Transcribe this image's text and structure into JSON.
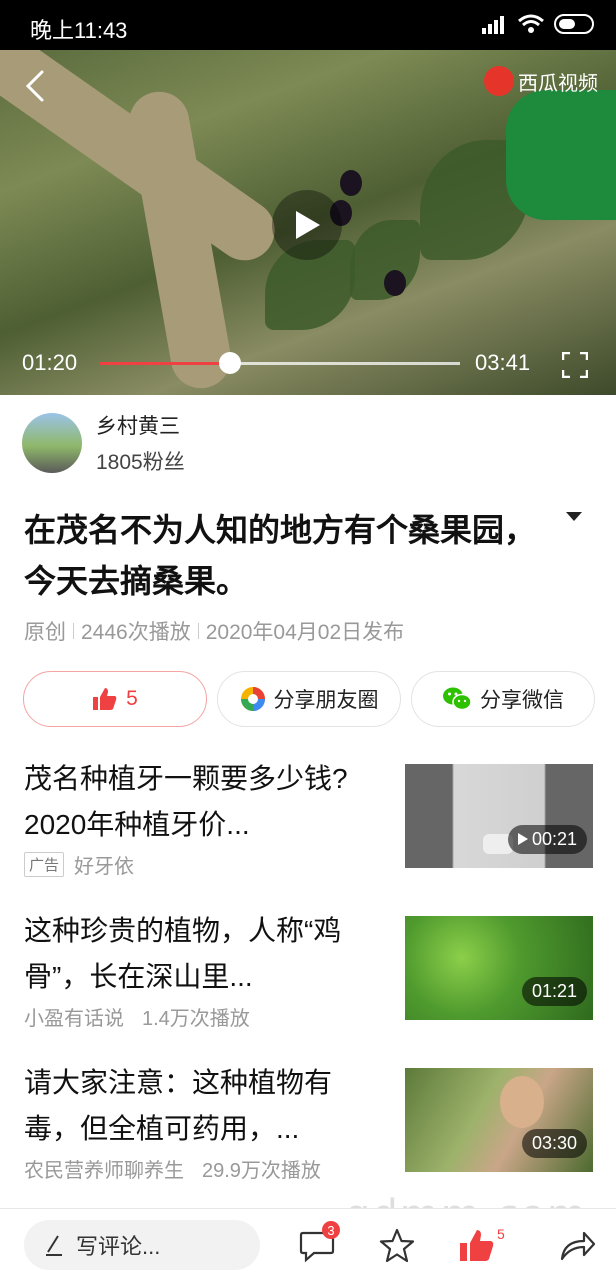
{
  "status_bar": {
    "time": "晚上11:43"
  },
  "video": {
    "source_logo": "西瓜视频",
    "current_time": "01:20",
    "total_time": "03:41",
    "progress": 0.36
  },
  "author": {
    "name": "乡村黄三",
    "fans": "1805粉丝"
  },
  "article": {
    "title": "在茂名不为人知的地方有个桑果园，今天去摘桑果。",
    "meta": [
      "原创",
      "2446次播放",
      "2020年04月02日发布"
    ]
  },
  "actions": {
    "like_count": "5",
    "share_moments": "分享朋友圈",
    "share_wechat": "分享微信"
  },
  "feed": [
    {
      "title": "茂名种植牙一颗要多少钱? 2020年种植牙价...",
      "ad_tag": "广告",
      "source": "好牙依",
      "count": "",
      "duration": "00:21"
    },
    {
      "title": "这种珍贵的植物，人称“鸡骨”，长在深山里...",
      "ad_tag": "",
      "source": "小盈有话说",
      "count": "1.4万次播放",
      "duration": "01:21"
    },
    {
      "title": "请大家注意：这种植物有毒，但全植可药用，...",
      "ad_tag": "",
      "source": "农民营养师聊养生",
      "count": "29.9万次播放",
      "duration": "03:30"
    }
  ],
  "bottom_bar": {
    "comment_placeholder": "写评论...",
    "comment_badge": "3",
    "like_badge": "5",
    "watermark": "gdmm.com"
  },
  "colors": {
    "accent": "#f04142",
    "wechat": "#2dc100"
  }
}
